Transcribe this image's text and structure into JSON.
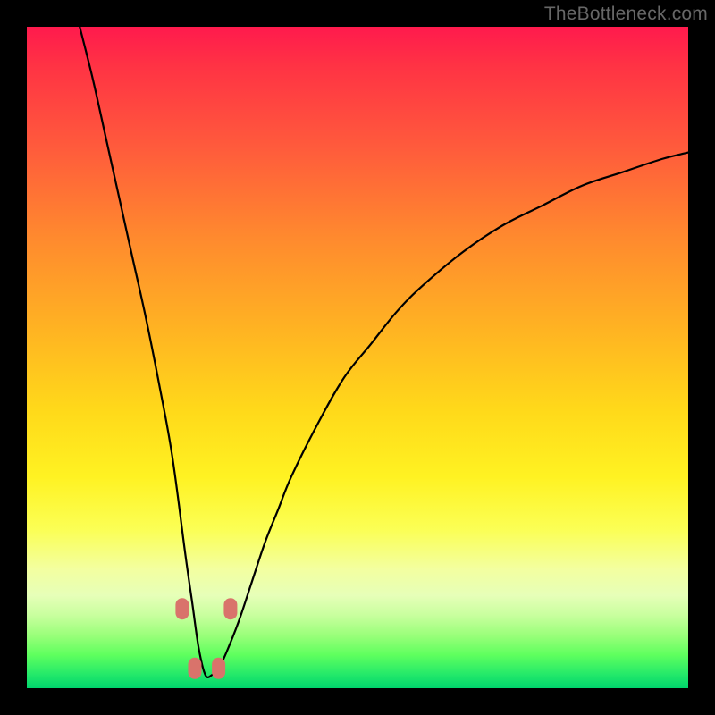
{
  "watermark": "TheBottleneck.com",
  "colors": {
    "background": "#000000",
    "curve_stroke": "#000000",
    "marker_fill": "#d9736b"
  },
  "chart_data": {
    "type": "line",
    "title": "",
    "xlabel": "",
    "ylabel": "",
    "xlim": [
      0,
      100
    ],
    "ylim": [
      0,
      100
    ],
    "notes": "V-shaped bottleneck curve; y is approximate percentage height read from gradient bands. Minimum near x≈27, floor ≈2%. Four rounded markers flank the trough.",
    "series": [
      {
        "name": "bottleneck-curve",
        "x": [
          8,
          10,
          12,
          14,
          16,
          18,
          20,
          22,
          24,
          25,
          26,
          27,
          28,
          29,
          30,
          32,
          34,
          36,
          38,
          40,
          44,
          48,
          52,
          56,
          60,
          66,
          72,
          78,
          84,
          90,
          96,
          100
        ],
        "y": [
          100,
          92,
          83,
          74,
          65,
          56,
          46,
          35,
          20,
          13,
          6,
          2,
          2,
          3,
          5,
          10,
          16,
          22,
          27,
          32,
          40,
          47,
          52,
          57,
          61,
          66,
          70,
          73,
          76,
          78,
          80,
          81
        ]
      }
    ],
    "markers": [
      {
        "x": 23.5,
        "y": 12
      },
      {
        "x": 25.4,
        "y": 3
      },
      {
        "x": 29.0,
        "y": 3
      },
      {
        "x": 30.8,
        "y": 12
      }
    ]
  }
}
